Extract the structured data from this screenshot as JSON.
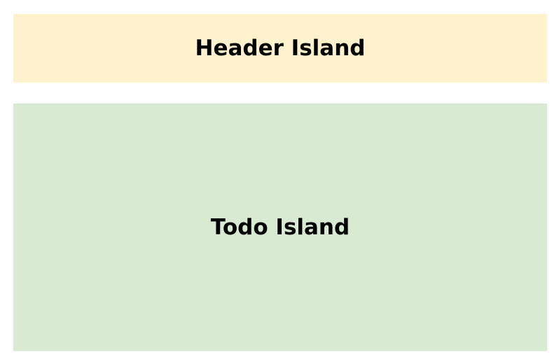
{
  "header": {
    "label": "Header Island",
    "color": "#fff2cc"
  },
  "todo": {
    "label": "Todo Island",
    "color": "#d9ead3"
  }
}
